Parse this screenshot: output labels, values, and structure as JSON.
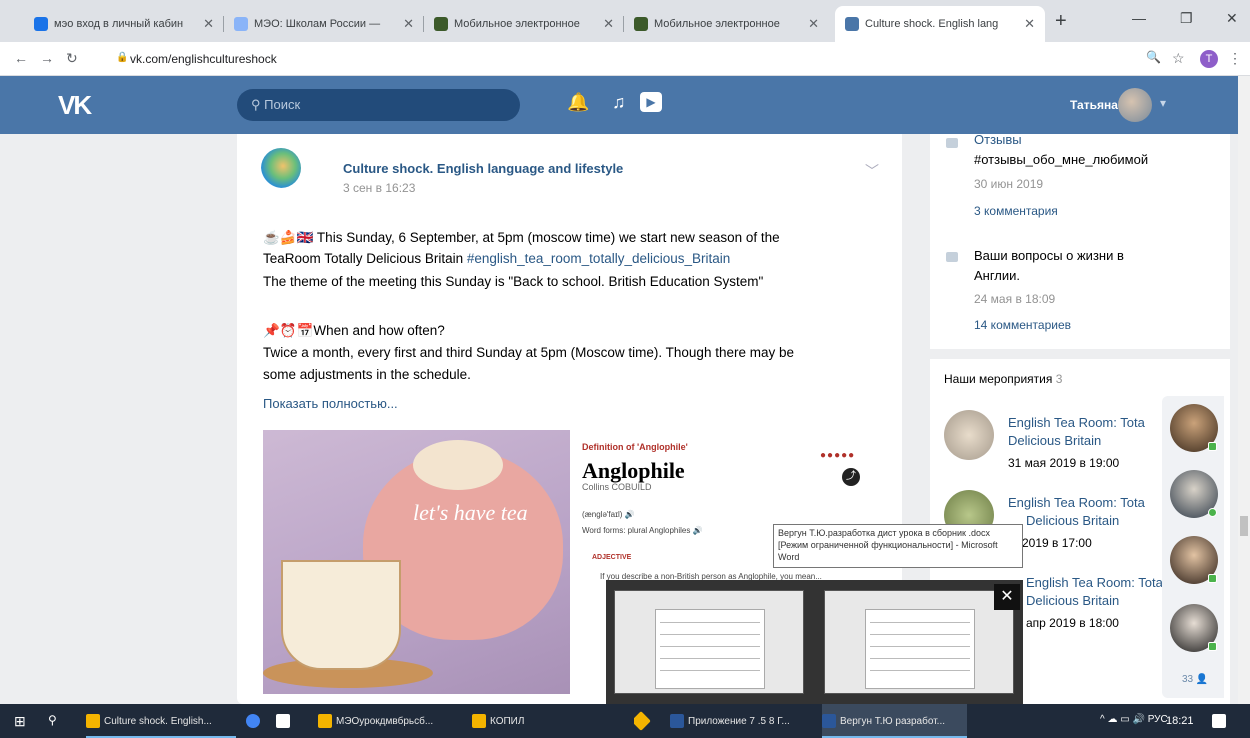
{
  "browser": {
    "tabs": [
      {
        "title": "мэо вход в личный кабин",
        "color": "#1a73e8"
      },
      {
        "title": "МЭО: Школам России — ",
        "color": "#8ab4f8"
      },
      {
        "title": "Мобильное электронное",
        "color": "#3c5a2a"
      },
      {
        "title": "Мобильное электронное",
        "color": "#3c5a2a"
      },
      {
        "title": "Culture shock. English lang",
        "color": "#4a76a8"
      }
    ],
    "new_tab": "+",
    "url": "vk.com/englishcultureshock",
    "profile_letter": "T"
  },
  "vk": {
    "logo": "VK",
    "search_placeholder": "Поиск",
    "user_name": "Татьяна"
  },
  "post": {
    "group_name": "Culture shock. English language and lifestyle",
    "date": "3 сен в 16:23",
    "line1": "☕🍰🇬🇧 This Sunday, 6 September, at 5pm (moscow time) we start new season of the",
    "line2_text": "TeaRoom Totally Delicious Britain ",
    "line2_hashtag": "#english_tea_room_totally_delicious_Britain",
    "line3": "The theme of the meeting this Sunday is \"Back to school. British Education System\"",
    "line4": "📌⏰📅When and how often?",
    "line5": "Twice a month, every first and third Sunday at 5pm (Moscow time). Though there may be",
    "line6": "some adjustments in the schedule.",
    "show_more": "Показать полностью...",
    "image_text": "let's have tea",
    "definition": {
      "label": "Definition of 'Anglophile'",
      "word": "Anglophile",
      "source": "Collins COBUILD",
      "pron": "(ænglə'faɪl) 🔊",
      "forms": "Word forms: plural Anglophiles 🔊",
      "adjective": "ADJECTIVE",
      "desc": "If you describe a non-British person as Anglophile, you mean..."
    }
  },
  "sidebar": {
    "discussions": [
      {
        "title": "Отзывы",
        "subtitle": "#отзывы_обо_мне_любимой",
        "date": "30 июн 2019",
        "comments": "3 комментария"
      },
      {
        "title": "Ваши вопросы о жизни в",
        "subtitle": "Англии.",
        "date": "24 мая в 18:09",
        "comments": "14 комментариев"
      }
    ],
    "events_title": "Наши мероприятия",
    "events_count": "3",
    "events": [
      {
        "name1": "English Tea Room: Tota",
        "name2": "Delicious Britain",
        "date": "31 мая 2019 в 19:00"
      },
      {
        "name1": "English Tea Room: Tota",
        "name2": "Delicious Britain",
        "date": "2019 в 17:00"
      },
      {
        "name1": "English Tea Room: Tota",
        "name2": "Delicious Britain",
        "date": "апр 2019 в 18:00"
      }
    ],
    "friends_count": "33"
  },
  "tooltip": "Вергун Т.Ю.разработка дист урока в сборник .docx [Режим ограниченной функциональности] - Microsoft Word",
  "taskbar": {
    "items": [
      {
        "label": "Culture shock. English...",
        "color": "#f4b400"
      },
      {
        "label": "",
        "color": "#4285f4"
      },
      {
        "label": "",
        "color": "#fff"
      },
      {
        "label": "МЭОурокдмвбрьсб...",
        "color": "#f4b400"
      },
      {
        "label": "КОПИЛ",
        "color": "#f4b400"
      },
      {
        "label": "",
        "color": "#f4b400"
      },
      {
        "label": "Приложение 7 .5 8 Г...",
        "color": "#2b579a"
      },
      {
        "label": "Вергун Т.Ю разработ...",
        "color": "#2b579a"
      }
    ],
    "lang": "РУС",
    "time": "18:21"
  }
}
